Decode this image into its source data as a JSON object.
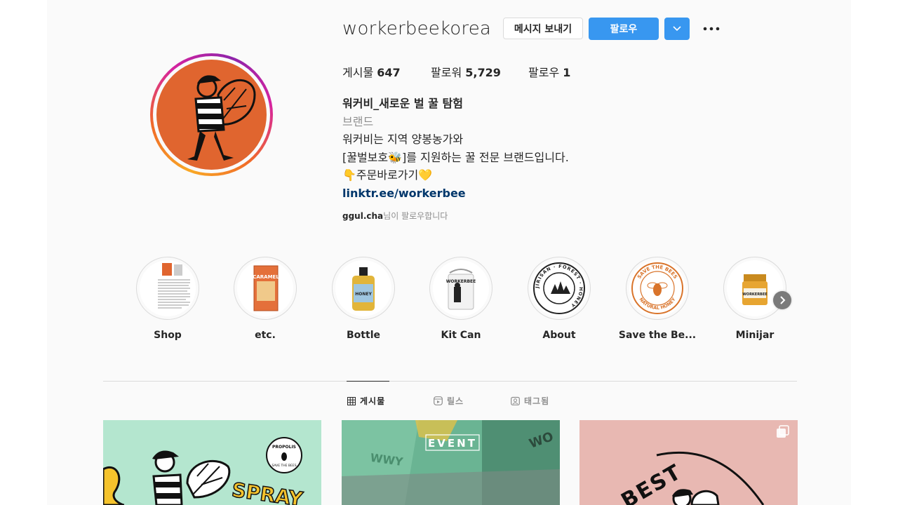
{
  "profile": {
    "username": "workerbeekorea",
    "message_button": "메시지 보내기",
    "follow_button": "팔로우"
  },
  "stats": {
    "posts_label": "게시물",
    "posts_count": "647",
    "followers_label": "팔로워",
    "followers_count": "5,729",
    "following_label": "팔로우",
    "following_count": "1"
  },
  "bio": {
    "name": "워커비_새로운 벌 꿀 탐험",
    "category": "브랜드",
    "line1": "워커비는 지역 양봉농가와",
    "line2_prefix": "[꿀벌보호",
    "line2_emoji": "🐝",
    "line2_suffix": "]를 지원하는 꿀 전문 브랜드입니다.",
    "line3_emoji_left": "👇",
    "line3_text": "주문바로가기",
    "line3_emoji_right": "💛",
    "link": "linktr.ee/workerbee"
  },
  "followed_by": {
    "user": "ggul.cha",
    "suffix": "님이 팔로우합니다"
  },
  "highlights": [
    {
      "label": "Shop"
    },
    {
      "label": "etc."
    },
    {
      "label": "Bottle"
    },
    {
      "label": "Kit Can"
    },
    {
      "label": "About"
    },
    {
      "label": "Save the Be..."
    },
    {
      "label": "Minijar"
    }
  ],
  "highlight_art_text": {
    "caramel": "CARAMEL",
    "bottle": "HONEY",
    "kitcan": "WORKERBEE",
    "about_ring": "JIRISAN · FOREST · HONEY",
    "save_top": "SAVE THE BEES",
    "save_bottom": "NATURAL HONEY",
    "minijar": "WORKERBEE"
  },
  "tabs": [
    {
      "label": "게시물",
      "icon": "grid-icon",
      "active": true
    },
    {
      "label": "릴스",
      "icon": "reels-icon",
      "active": false
    },
    {
      "label": "태그됨",
      "icon": "tagged-icon",
      "active": false
    }
  ],
  "posts": {
    "post1_text": "SPRAY",
    "post1_badge_top": "PROPOLIS",
    "post1_badge_bottom": "SAVE THE BEES",
    "post2_text": "EVENT",
    "post3_text": "BEST"
  },
  "colors": {
    "follow_blue": "#3897f0",
    "avatar_orange": "#e0652f",
    "link_navy": "#00376b"
  }
}
